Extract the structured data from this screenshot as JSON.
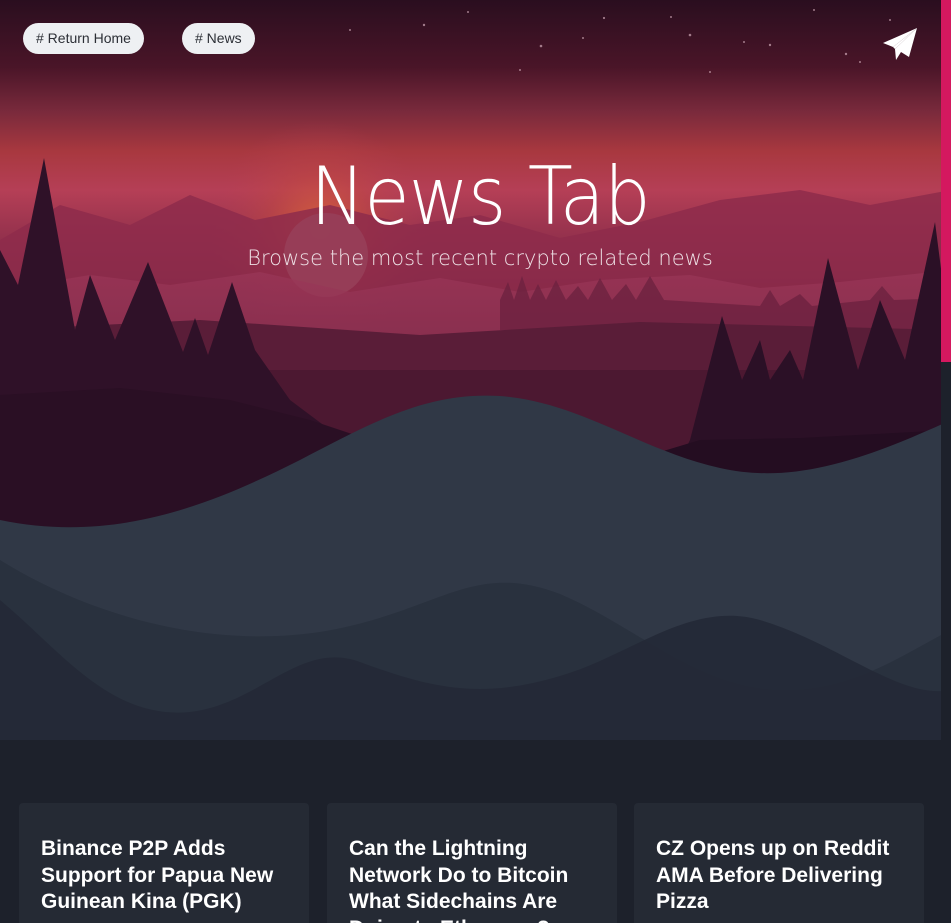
{
  "nav": {
    "return_home": "# Return Home",
    "news": "# News"
  },
  "header": {
    "send_icon": "paper-plane-icon",
    "title": "News Tab",
    "subtitle": "Browse the most recent crypto related news"
  },
  "theme": {
    "accent": "#d4185f",
    "page_background": "#1d212b",
    "card_background": "#252a34",
    "sky_top": "#2a0e1f",
    "sky_glow": "#c0345a"
  },
  "articles": [
    {
      "title": "Binance P2P Adds Support for Papua New Guinean Kina (PGK)"
    },
    {
      "title": "Can the Lightning Network Do to Bitcoin What Sidechains Are Doing to Ethereum?"
    },
    {
      "title": "CZ Opens up on Reddit AMA Before Delivering Pizza"
    }
  ]
}
